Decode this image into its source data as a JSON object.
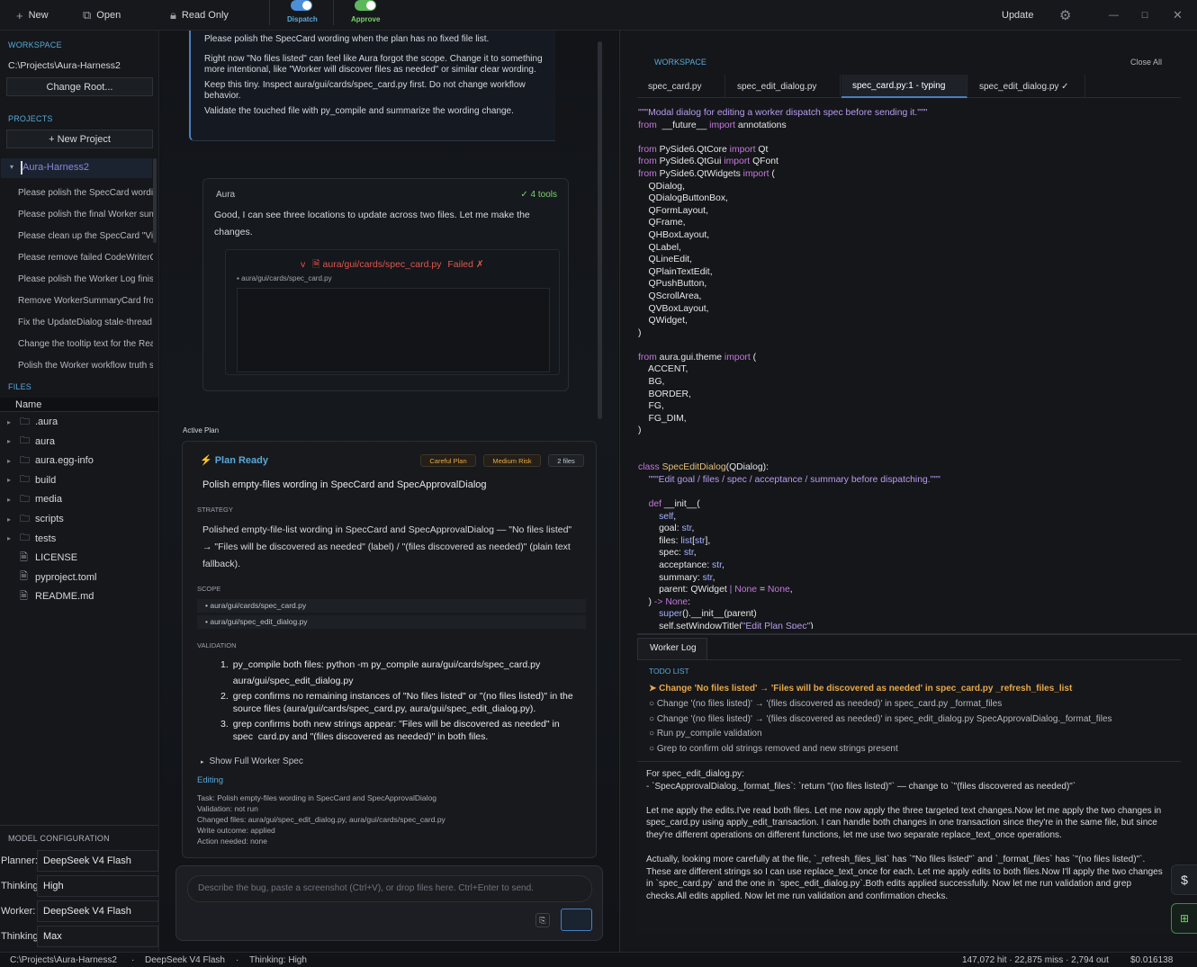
{
  "toolbar": {
    "new_label": "New",
    "open_label": "Open",
    "readonly_label": "Read Only",
    "dispatch_label": "Dispatch",
    "approve_label": "Approve",
    "update_label": "Update"
  },
  "workspace": {
    "heading": "WORKSPACE",
    "path": "C:\\Projects\\Aura-Harness2",
    "change_root": "Change Root..."
  },
  "projects": {
    "heading": "PROJECTS",
    "new_project": "+  New Project",
    "active": "Aura-Harness2",
    "items": [
      "Please polish the SpecCard wording",
      "Please polish the final Worker summ",
      "Please clean up the SpecCard \"View",
      "Please remove failed CodeWriterCa",
      "Please polish the Worker Log finish",
      "Remove WorkerSummaryCard from",
      "Fix the UpdateDialog stale-thread b",
      "Change the tooltip text for the Reac",
      "Polish the Worker workflow truth st"
    ]
  },
  "files": {
    "heading": "FILES",
    "column": "Name",
    "items": [
      {
        "name": ".aura",
        "type": "folder"
      },
      {
        "name": "aura",
        "type": "folder"
      },
      {
        "name": "aura.egg-info",
        "type": "folder"
      },
      {
        "name": "build",
        "type": "folder"
      },
      {
        "name": "media",
        "type": "folder"
      },
      {
        "name": "scripts",
        "type": "folder"
      },
      {
        "name": "tests",
        "type": "folder"
      },
      {
        "name": "LICENSE",
        "type": "file"
      },
      {
        "name": "pyproject.toml",
        "type": "file"
      },
      {
        "name": "README.md",
        "type": "file"
      }
    ]
  },
  "model": {
    "heading": "MODEL CONFIGURATION",
    "rows": [
      {
        "label": "Planner:",
        "value": "DeepSeek V4 Flash"
      },
      {
        "label": "Thinking:",
        "value": "High"
      },
      {
        "label": "Worker:",
        "value": "DeepSeek V4 Flash"
      },
      {
        "label": "Thinking:",
        "value": "Max"
      }
    ]
  },
  "chat": {
    "user_msg": [
      "Please polish the SpecCard wording when the plan has no fixed file list.",
      "Right now \"No files listed\" can feel like Aura forgot the scope. Change it to something more intentional, like \"Worker will discover files as needed\" or similar clear wording.",
      "Keep this tiny. Inspect aura/gui/cards/spec_card.py first. Do not change workflow behavior.",
      "Validate the touched file with py_compile and summarize the wording change."
    ],
    "aura_name": "Aura",
    "tools_badge": "✓ 4 tools",
    "aura_text": "Good, I can see three locations to update across two files. Let me make the changes.",
    "tool_prefix": "v",
    "tool_path": "aura/gui/cards/spec_card.py",
    "tool_status": "Failed ✗",
    "tool_subpath": "aura/gui/cards/spec_card.py"
  },
  "plan": {
    "section_label": "Active Plan",
    "status": "Plan Ready",
    "badges": [
      "Careful Plan",
      "Medium Risk",
      "2 files"
    ],
    "title": "Polish empty-files wording in SpecCard and SpecApprovalDialog",
    "strategy_heading": "STRATEGY",
    "strategy": "Polished empty-file-list wording in SpecCard and SpecApprovalDialog — \"No files listed\" → \"Files will be discovered as needed\" (label) / \"(files discovered as needed)\" (plain text fallback).",
    "scope_heading": "SCOPE",
    "scope": [
      "• aura/gui/cards/spec_card.py",
      "• aura/gui/spec_edit_dialog.py"
    ],
    "validation_heading": "VALIDATION",
    "validation": [
      "py_compile both files: python -m py_compile aura/gui/cards/spec_card.py aura/gui/spec_edit_dialog.py",
      "grep confirms no remaining instances of \"No files listed\" or \"(no files listed)\" in the source files (aura/gui/cards/spec_card.py, aura/gui/spec_edit_dialog.py).",
      "grep confirms both new strings appear: \"Files will be discovered as needed\" in spec_card.py and \"(files discovered as needed)\" in both files."
    ],
    "show_spec": "Show Full Worker Spec",
    "editing": "Editing",
    "summary": [
      "Task: Polish empty-files wording in SpecCard and SpecApprovalDialog",
      "Validation: not run",
      "Changed files: aura/gui/spec_edit_dialog.py, aura/gui/cards/spec_card.py",
      "Write outcome: applied",
      "Action needed: none"
    ]
  },
  "composer": {
    "placeholder": "Describe the bug, paste a screenshot (Ctrl+V), or drop files here. Ctrl+Enter to send."
  },
  "editor": {
    "heading": "WORKSPACE",
    "close_all": "Close All",
    "tabs": [
      "spec_card.py",
      "spec_edit_dialog.py",
      "spec_card.py:1 - typing",
      "spec_edit_dialog.py ✓"
    ],
    "active_tab": 2
  },
  "code": [
    [
      [
        "st",
        "\"\"\"Modal dialog for editing a worker dispatch spec before sending it.\"\"\""
      ]
    ],
    [
      [
        "kw",
        "from"
      ],
      [
        "",
        "  __future__ "
      ],
      [
        "kw",
        "import"
      ],
      [
        "",
        " annotations"
      ]
    ],
    [
      [
        "",
        ""
      ]
    ],
    [
      [
        "kw",
        "from"
      ],
      [
        "",
        " PySide6.QtCore "
      ],
      [
        "kw",
        "import"
      ],
      [
        "",
        " Qt"
      ]
    ],
    [
      [
        "kw",
        "from"
      ],
      [
        "",
        " PySide6.QtGui "
      ],
      [
        "kw",
        "import"
      ],
      [
        "",
        " QFont"
      ]
    ],
    [
      [
        "kw",
        "from"
      ],
      [
        "",
        " PySide6.QtWidgets "
      ],
      [
        "kw",
        "import"
      ],
      [
        "",
        " ("
      ]
    ],
    [
      [
        "",
        "    QDialog,"
      ]
    ],
    [
      [
        "",
        "    QDialogButtonBox,"
      ]
    ],
    [
      [
        "",
        "    QFormLayout,"
      ]
    ],
    [
      [
        "",
        "    QFrame,"
      ]
    ],
    [
      [
        "",
        "    QHBoxLayout,"
      ]
    ],
    [
      [
        "",
        "    QLabel,"
      ]
    ],
    [
      [
        "",
        "    QLineEdit,"
      ]
    ],
    [
      [
        "",
        "    QPlainTextEdit,"
      ]
    ],
    [
      [
        "",
        "    QPushButton,"
      ]
    ],
    [
      [
        "",
        "    QScrollArea,"
      ]
    ],
    [
      [
        "",
        "    QVBoxLayout,"
      ]
    ],
    [
      [
        "",
        "    QWidget,"
      ]
    ],
    [
      [
        "",
        ")"
      ]
    ],
    [
      [
        "",
        ""
      ]
    ],
    [
      [
        "kw",
        "from"
      ],
      [
        "",
        " aura.gui.theme "
      ],
      [
        "kw",
        "import"
      ],
      [
        "",
        " ("
      ]
    ],
    [
      [
        "",
        "    ACCENT,"
      ]
    ],
    [
      [
        "",
        "    BG,"
      ]
    ],
    [
      [
        "",
        "    BORDER,"
      ]
    ],
    [
      [
        "",
        "    FG,"
      ]
    ],
    [
      [
        "",
        "    FG_DIM,"
      ]
    ],
    [
      [
        "",
        ")"
      ]
    ],
    [
      [
        "",
        ""
      ]
    ],
    [
      [
        "",
        ""
      ]
    ],
    [
      [
        "kw",
        "class"
      ],
      [
        "",
        " "
      ],
      [
        "cl",
        "SpecEditDialog"
      ],
      [
        "",
        "(QDialog):"
      ]
    ],
    [
      [
        "",
        "    "
      ],
      [
        "st",
        "\"\"\"Edit goal / files / spec / acceptance / summary before dispatching.\"\"\""
      ]
    ],
    [
      [
        "",
        ""
      ]
    ],
    [
      [
        "",
        "    "
      ],
      [
        "kw",
        "def"
      ],
      [
        "",
        " __init__("
      ]
    ],
    [
      [
        "",
        "        "
      ],
      [
        "ty",
        "self"
      ],
      [
        "",
        ","
      ]
    ],
    [
      [
        "",
        "        goal: "
      ],
      [
        "ty",
        "str"
      ],
      [
        "",
        ","
      ]
    ],
    [
      [
        "",
        "        files: "
      ],
      [
        "ty",
        "list"
      ],
      [
        "",
        "["
      ],
      [
        "ty",
        "str"
      ],
      [
        "",
        "],"
      ]
    ],
    [
      [
        "",
        "        spec: "
      ],
      [
        "ty",
        "str"
      ],
      [
        "",
        ","
      ]
    ],
    [
      [
        "",
        "        acceptance: "
      ],
      [
        "ty",
        "str"
      ],
      [
        "",
        ","
      ]
    ],
    [
      [
        "",
        "        summary: "
      ],
      [
        "ty",
        "str"
      ],
      [
        "",
        ","
      ]
    ],
    [
      [
        "",
        "        parent: QWidget "
      ],
      [
        "kw",
        "|"
      ],
      [
        "",
        " "
      ],
      [
        "kw",
        "None"
      ],
      [
        "",
        " = "
      ],
      [
        "kw",
        "None"
      ],
      [
        "",
        ","
      ]
    ],
    [
      [
        "",
        "    ) "
      ],
      [
        "ar",
        "->"
      ],
      [
        "",
        " "
      ],
      [
        "kw",
        "None"
      ],
      [
        "",
        ":"
      ]
    ],
    [
      [
        "",
        "        "
      ],
      [
        "ty",
        "super"
      ],
      [
        "",
        "().__init__(parent)"
      ]
    ],
    [
      [
        "",
        "        self.setWindowTitle("
      ],
      [
        "st",
        "\"Edit Plan Spec\""
      ],
      [
        "",
        ")"
      ]
    ]
  ],
  "worker_log": {
    "tab": "Worker Log",
    "todo_heading": "TODO LIST",
    "active": "➤ Change 'No files listed' → 'Files will be discovered as needed' in spec_card.py _refresh_files_list",
    "items": [
      "○ Change '(no files listed)' → '(files discovered as needed)' in spec_card.py _format_files",
      "○ Change '(no files listed)' → '(files discovered as needed)' in spec_edit_dialog.py SpecApprovalDialog._format_files",
      "○ Run py_compile validation",
      "○ Grep to confirm old strings removed and new strings present"
    ],
    "log": [
      "For spec_edit_dialog.py:",
      "- `SpecApprovalDialog._format_files`: `return \"(no files listed)\"` — change to `\"(files discovered as needed)\"`",
      "",
      "Let me apply the edits.I've read both files. Let me now apply the three targeted text changes.Now let me apply the two changes in spec_card.py using apply_edit_transaction. I can handle both changes in one transaction since they're in the same file, but since they're different operations on different functions, let me use two separate replace_text_once operations.",
      "",
      "Actually, looking more carefully at the file, `_refresh_files_list` has `\"No files listed\"` and `_format_files` has `\"(no files listed)\"`. These are different strings so I can use replace_text_once for each. Let me apply edits to both files.Now I'll apply the two changes in `spec_card.py` and the one in `spec_edit_dialog.py`.Both edits applied successfully. Now let me run validation and grep checks.All edits applied. Now let me run validation and confirmation checks."
    ]
  },
  "side_buttons": {
    "dollar": "$"
  },
  "status": {
    "path": "C:\\Projects\\Aura-Harness2",
    "sep": "·",
    "model": "DeepSeek V4 Flash",
    "thinking": "Thinking: High",
    "tokens": "147,072 hit · 22,875 miss · 2,794 out",
    "cost": "$0.016138"
  },
  "colors": {
    "accent": "#5aa8d8",
    "success": "#7ad36b",
    "error": "#e0564f",
    "warning": "#e8a848",
    "keyword": "#c678dd"
  }
}
